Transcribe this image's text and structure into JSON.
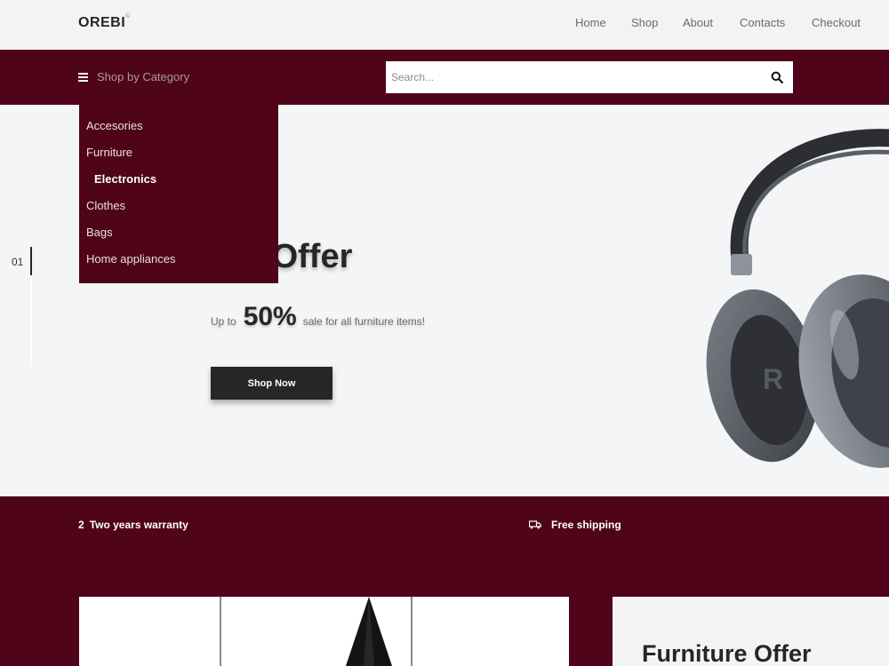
{
  "brand": {
    "name": "OREBI",
    "mark": "©"
  },
  "nav": {
    "home": "Home",
    "shop": "Shop",
    "about": "About",
    "contacts": "Contacts",
    "checkout": "Checkout"
  },
  "category_bar": {
    "label": "Shop by Category",
    "search_placeholder": "Search..."
  },
  "categories": [
    "Accesories",
    "Furniture",
    "Electronics",
    "Clothes",
    "Bags",
    "Home appliances"
  ],
  "active_category": "Electronics",
  "hero": {
    "slide_number": "01",
    "title": "Sale Offer",
    "title_visible": "l Offer",
    "sub_prefix": "Up to",
    "percent": "50%",
    "sub_suffix": "sale for all furniture items!",
    "button": "Shop Now"
  },
  "features": {
    "warranty_badge": "2",
    "warranty": "Two years warranty",
    "shipping": "Free shipping"
  },
  "promo": {
    "title": "Furniture Offer"
  },
  "colors": {
    "accent": "#4f0419",
    "topbar": "#f3f3f1",
    "hero_bg": "#f4f5f7",
    "button": "#262626"
  },
  "icons": [
    "hamburger-icon",
    "search-icon",
    "truck-icon"
  ]
}
